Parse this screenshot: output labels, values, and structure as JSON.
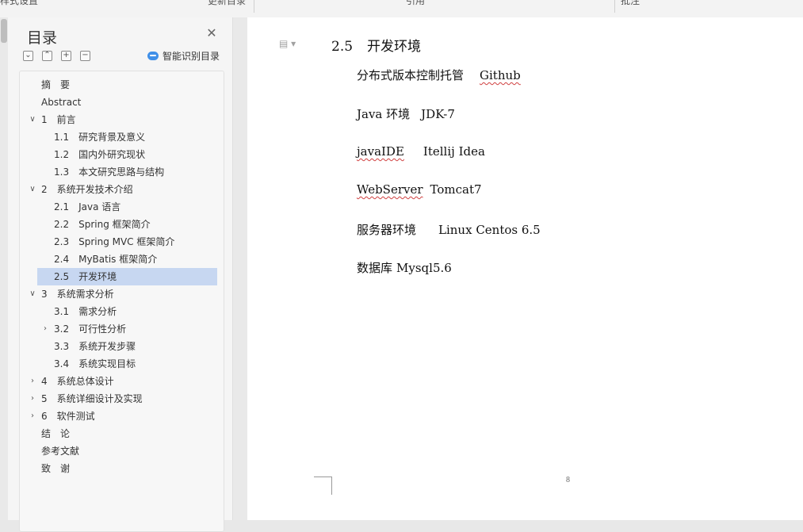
{
  "toolbar": {
    "items": [
      "样式设置",
      "更新目录",
      "引用",
      "批注"
    ]
  },
  "toc": {
    "title": "目录",
    "close_icon": "close-icon",
    "smart_label": "智能识别目录",
    "items": [
      {
        "label": "摘　要",
        "level": 0,
        "chevron": ""
      },
      {
        "label": "Abstract",
        "level": 0,
        "chevron": ""
      },
      {
        "label": "1　前言",
        "level": 0,
        "chevron": "down"
      },
      {
        "label": "1.1　研究背景及意义",
        "level": 1,
        "chevron": ""
      },
      {
        "label": "1.2　国内外研究现状",
        "level": 1,
        "chevron": ""
      },
      {
        "label": "1.3　本文研究思路与结构",
        "level": 1,
        "chevron": ""
      },
      {
        "label": "2　系统开发技术介绍",
        "level": 0,
        "chevron": "down"
      },
      {
        "label": "2.1　Java 语言",
        "level": 1,
        "chevron": ""
      },
      {
        "label": "2.2　Spring 框架简介",
        "level": 1,
        "chevron": ""
      },
      {
        "label": "2.3　Spring MVC 框架简介",
        "level": 1,
        "chevron": ""
      },
      {
        "label": "2.4　MyBatis 框架简介",
        "level": 1,
        "chevron": ""
      },
      {
        "label": "2.5　开发环境",
        "level": 1,
        "chevron": "",
        "active": true
      },
      {
        "label": "3　系统需求分析",
        "level": 0,
        "chevron": "down"
      },
      {
        "label": "3.1　需求分析",
        "level": 1,
        "chevron": ""
      },
      {
        "label": "3.2　可行性分析",
        "level": 1,
        "chevron": "right"
      },
      {
        "label": "3.3　系统开发步骤",
        "level": 1,
        "chevron": ""
      },
      {
        "label": "3.4　系统实现目标",
        "level": 1,
        "chevron": ""
      },
      {
        "label": "4　系统总体设计",
        "level": 0,
        "chevron": "right"
      },
      {
        "label": "5　系统详细设计及实现",
        "level": 0,
        "chevron": "right"
      },
      {
        "label": "6　软件测试",
        "level": 0,
        "chevron": "right"
      },
      {
        "label": "结　论",
        "level": 0,
        "chevron": ""
      },
      {
        "label": "参考文献",
        "level": 0,
        "chevron": ""
      },
      {
        "label": "致　谢",
        "level": 0,
        "chevron": ""
      }
    ]
  },
  "document": {
    "heading_number": "2.5",
    "heading_text": "开发环境",
    "lines": [
      {
        "label": "分布式版本控制托管",
        "value": "Github"
      },
      {
        "label": "Java 环境",
        "value": "JDK-7"
      },
      {
        "label": "javaIDE",
        "value": "Itellij Idea"
      },
      {
        "label": "WebServer",
        "value": "Tomcat7"
      },
      {
        "label": "服务器环境",
        "value": "Linux Centos 6.5"
      },
      {
        "label": "数据库",
        "value": "Mysql5.6"
      }
    ],
    "page_number": "8"
  }
}
